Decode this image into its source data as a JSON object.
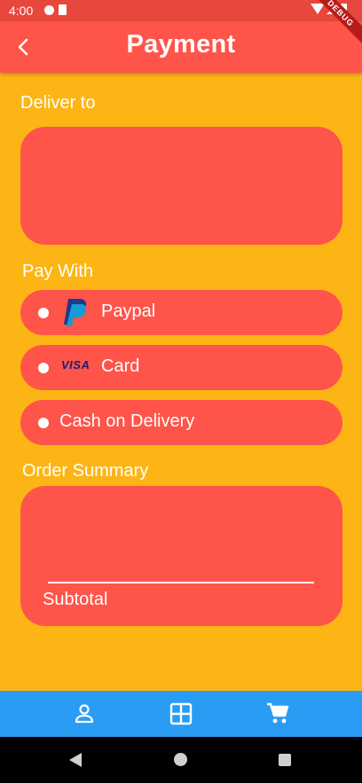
{
  "status_bar": {
    "time": "4:00"
  },
  "app_bar": {
    "title": "Payment",
    "debug_banner": "DEBUG"
  },
  "deliver_section": {
    "label": "Deliver to"
  },
  "pay_section": {
    "label": "Pay With",
    "options": [
      {
        "label": "Paypal",
        "icon": "paypal-logo"
      },
      {
        "label": "Card",
        "icon": "visa-logo",
        "logo_text": "VISA"
      },
      {
        "label": "Cash on Delivery"
      }
    ]
  },
  "summary_section": {
    "label": "Order Summary",
    "subtotal_label": "Subtotal"
  },
  "bottom_nav": {
    "items": [
      "person-icon",
      "grid-icon",
      "cart-icon"
    ]
  },
  "colors": {
    "background": "#FDB515",
    "accent": "#FF5449",
    "nav": "#2B9CF3"
  }
}
